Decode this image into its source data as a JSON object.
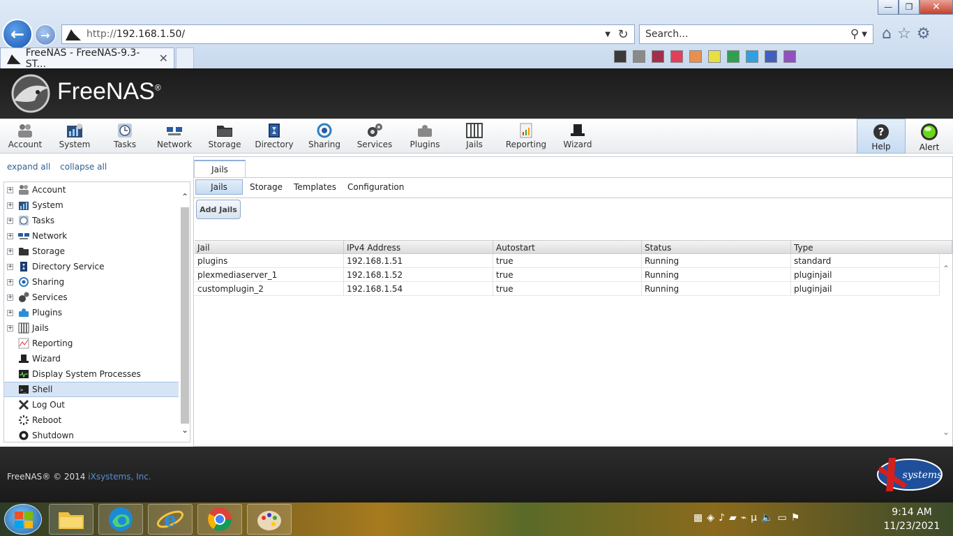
{
  "browser": {
    "url_scheme": "http://",
    "url_host": "192.168.1.50/",
    "search_placeholder": "Search...",
    "tab_title": "FreeNAS - FreeNAS-9.3-ST...",
    "window_controls": {
      "minimize": "—",
      "maximize": "❐",
      "close": "✕"
    }
  },
  "header": {
    "logo_text": "FreeNAS",
    "logo_reg": "®"
  },
  "toolbar": {
    "items": [
      {
        "label": "Account"
      },
      {
        "label": "System"
      },
      {
        "label": "Tasks"
      },
      {
        "label": "Network"
      },
      {
        "label": "Storage"
      },
      {
        "label": "Directory"
      },
      {
        "label": "Sharing"
      },
      {
        "label": "Services"
      },
      {
        "label": "Plugins"
      },
      {
        "label": "Jails"
      },
      {
        "label": "Reporting"
      },
      {
        "label": "Wizard"
      }
    ],
    "help": "Help",
    "alert": "Alert"
  },
  "tree": {
    "expand_all": "expand all",
    "collapse_all": "collapse all",
    "items": [
      {
        "label": "Account",
        "expandable": true
      },
      {
        "label": "System",
        "expandable": true
      },
      {
        "label": "Tasks",
        "expandable": true
      },
      {
        "label": "Network",
        "expandable": true
      },
      {
        "label": "Storage",
        "expandable": true
      },
      {
        "label": "Directory Service",
        "expandable": true
      },
      {
        "label": "Sharing",
        "expandable": true
      },
      {
        "label": "Services",
        "expandable": true
      },
      {
        "label": "Plugins",
        "expandable": true
      },
      {
        "label": "Jails",
        "expandable": true
      },
      {
        "label": "Reporting",
        "expandable": false
      },
      {
        "label": "Wizard",
        "expandable": false
      },
      {
        "label": "Display System Processes",
        "expandable": false
      },
      {
        "label": "Shell",
        "expandable": false,
        "selected": true
      },
      {
        "label": "Log Out",
        "expandable": false
      },
      {
        "label": "Reboot",
        "expandable": false
      },
      {
        "label": "Shutdown",
        "expandable": false
      }
    ]
  },
  "main": {
    "top_tab": "Jails",
    "subtabs": [
      "Jails",
      "Storage",
      "Templates",
      "Configuration"
    ],
    "add_button": "Add Jails",
    "columns": [
      "Jail",
      "IPv4 Address",
      "Autostart",
      "Status",
      "Type"
    ],
    "rows": [
      [
        "plugins",
        "192.168.1.51",
        "true",
        "Running",
        "standard"
      ],
      [
        "plexmediaserver_1",
        "192.168.1.52",
        "true",
        "Running",
        "pluginjail"
      ],
      [
        "customplugin_2",
        "192.168.1.54",
        "true",
        "Running",
        "pluginjail"
      ]
    ]
  },
  "footer": {
    "copyright": "FreeNAS® © 2014",
    "company_link": "iXsystems, Inc.",
    "ix_logo_text": "systems"
  },
  "taskbar": {
    "time": "9:14 AM",
    "date": "11/23/2021"
  },
  "colors": {
    "accent_blue": "#2f5f95",
    "header_dark": "#1b1b1b",
    "selected_row": "#d6e4f5"
  }
}
